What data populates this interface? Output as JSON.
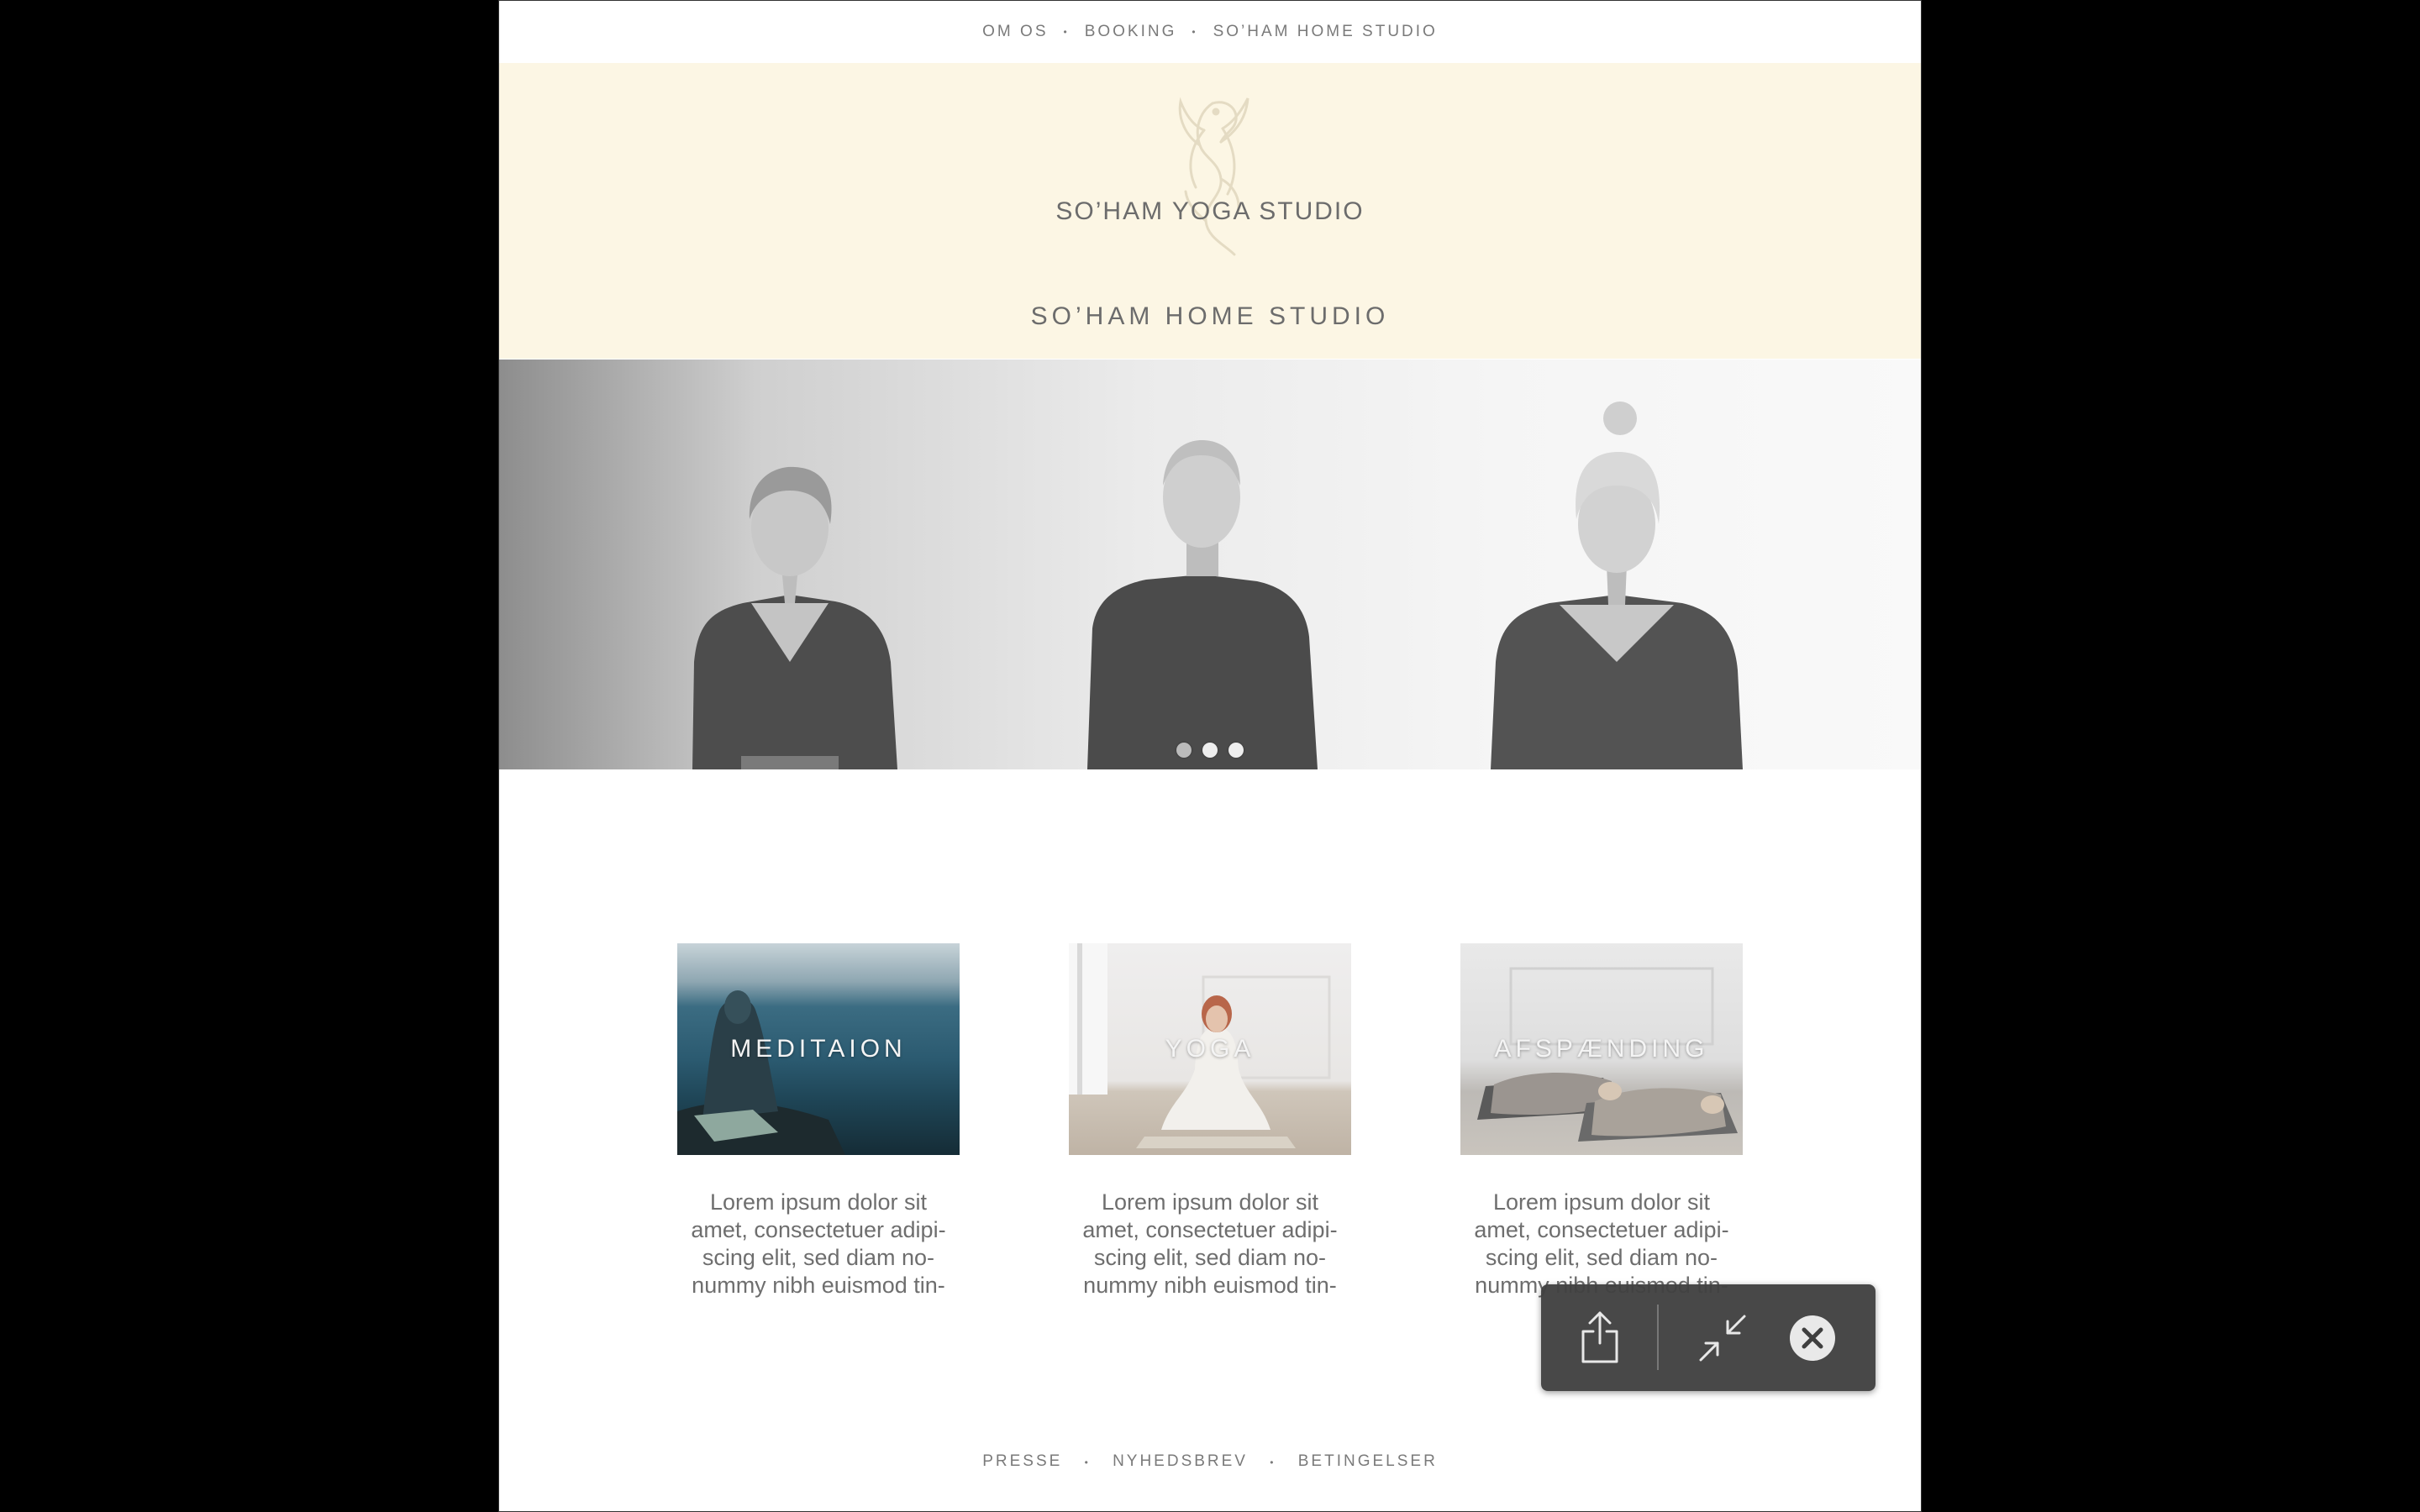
{
  "top_nav": {
    "items": [
      "OM OS",
      "BOOKING",
      "SO’HAM HOME STUDIO"
    ],
    "separator": "•"
  },
  "header": {
    "brand": "SO’HAM YOGA STUDIO",
    "subtitle": "SO’HAM HOME STUDIO",
    "background": "#fcf6e4"
  },
  "hero": {
    "slides_total": 3,
    "active_slide": 1
  },
  "cards": [
    {
      "label": "MEDITAION",
      "text": "Lorem ipsum dolor sit amet, consectetuer adipi-scing elit, sed diam no-nummy nibh euismod tin-"
    },
    {
      "label": "YOGA",
      "text": "Lorem ipsum dolor sit amet, consectetuer adipi-scing elit, sed diam no-nummy nibh euismod tin-"
    },
    {
      "label": "AFSPÆNDING",
      "text": "Lorem ipsum dolor sit amet, consectetuer adipi-scing elit, sed diam no-nummy nibh euismod tin-"
    }
  ],
  "overlay": {
    "buttons": [
      "share-icon",
      "exit-fullscreen-icon",
      "close-icon"
    ]
  },
  "footer": {
    "items": [
      "PRESSE",
      "NYHEDSBREV",
      "BETINGELSER"
    ],
    "separator": "•"
  }
}
